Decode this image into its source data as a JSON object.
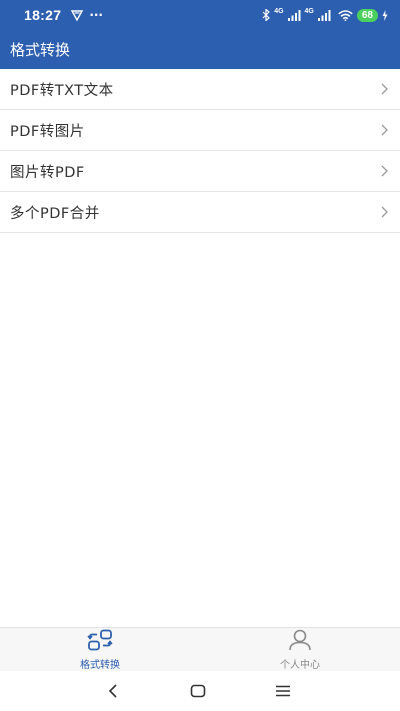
{
  "status_bar": {
    "time": "18:27",
    "more_indicator": "···",
    "network_1": "4G",
    "network_2": "4G",
    "battery": "68"
  },
  "app_bar": {
    "title": "格式转换"
  },
  "menu": {
    "items": [
      {
        "label": "PDF转TXT文本"
      },
      {
        "label": "PDF转图片"
      },
      {
        "label": "图片转PDF"
      },
      {
        "label": "多个PDF合并"
      }
    ]
  },
  "bottom_nav": {
    "tabs": [
      {
        "label": "格式转换",
        "icon": "convert-icon",
        "active": true
      },
      {
        "label": "个人中心",
        "icon": "person-icon",
        "active": false
      }
    ]
  },
  "colors": {
    "primary": "#2d5fb0",
    "battery": "#4cd05d",
    "text": "#333333",
    "inactive": "#888888"
  }
}
